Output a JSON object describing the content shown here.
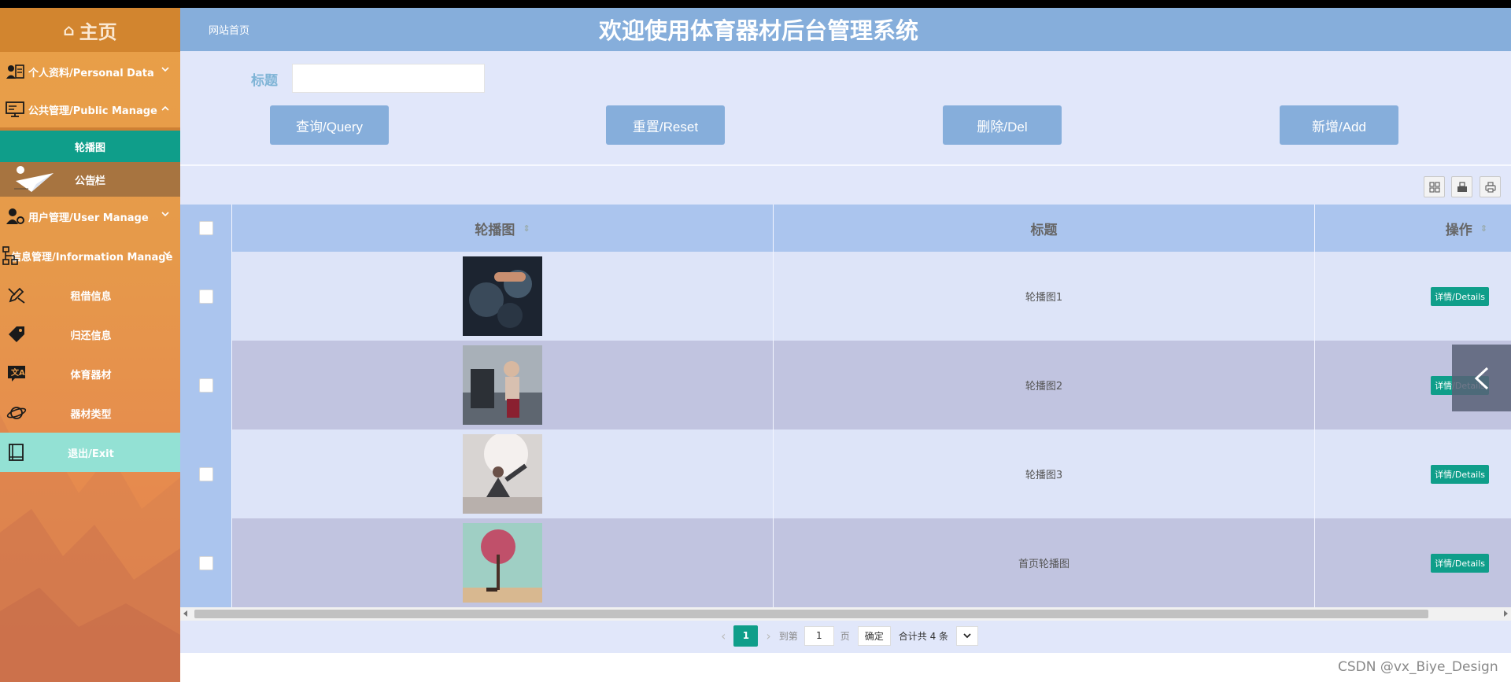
{
  "sidebar": {
    "home_label": "主页",
    "menus": [
      {
        "label": "个人资料/Personal Data",
        "icon": "user-card-icon",
        "state": "collapsed"
      },
      {
        "label": "公共管理/Public Manage",
        "icon": "monitor-icon",
        "state": "expanded"
      },
      {
        "label": "用户管理/User Manage",
        "icon": "user-gear-icon",
        "state": "collapsed"
      },
      {
        "label": "信息管理/Information Manage",
        "icon": "org-chart-icon",
        "state": "collapsed"
      }
    ],
    "public_sub": [
      {
        "label": "轮播图"
      },
      {
        "label": "公告栏"
      }
    ],
    "info_sub": [
      {
        "label": "租借信息",
        "icon": "edit-icon"
      },
      {
        "label": "归还信息",
        "icon": "tag-icon"
      },
      {
        "label": "体育器材",
        "icon": "translate-icon"
      },
      {
        "label": "器材类型",
        "icon": "planet-icon"
      }
    ],
    "exit_label": "退出/Exit"
  },
  "header": {
    "site_link": "网站首页",
    "title": "欢迎使用体育器材后台管理系统"
  },
  "search": {
    "label": "标题",
    "value": "",
    "placeholder": ""
  },
  "buttons": {
    "query": "查询/Query",
    "reset": "重置/Reset",
    "delete": "删除/Del",
    "add": "新增/Add"
  },
  "table": {
    "columns": [
      "轮播图",
      "标题",
      "操作"
    ],
    "rows": [
      {
        "title": "轮播图1",
        "action": "详情/Details"
      },
      {
        "title": "轮播图2",
        "action": "详情/Details"
      },
      {
        "title": "轮播图3",
        "action": "详情/Details"
      },
      {
        "title": "首页轮播图",
        "action": "详情/Details"
      }
    ]
  },
  "pager": {
    "current": "1",
    "goto_label": "到第",
    "goto_value": "1",
    "page_unit": "页",
    "confirm": "确定",
    "total": "合计共 4 条"
  },
  "watermark": "CSDN @vx_Biye_Design",
  "colors": {
    "header": "#86aedb",
    "accent": "#0f9e8a",
    "sidebar": "#e69a4a",
    "content_bg": "#e1e7fa"
  }
}
